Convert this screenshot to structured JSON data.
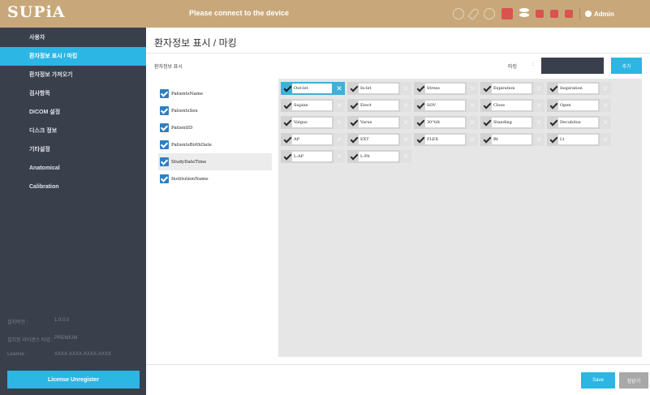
{
  "app": {
    "logo": "SUPiA",
    "device_message": "Please connect to the device",
    "user": "Admin"
  },
  "colors": {
    "accent": "#2bb6e4",
    "sidebar": "#3a3f4c",
    "titlebar": "#c8a87a",
    "checkbox": "#2f7fc1",
    "status_alert": "#d9534f"
  },
  "header_icons": [
    "status-circle-icon",
    "paperclip-icon",
    "status-circle-icon",
    "red-square-icon",
    "database-icon",
    "red-square-icon",
    "red-square-icon",
    "red-square-icon"
  ],
  "sidebar": {
    "items": [
      {
        "label": "사용자"
      },
      {
        "label": "환자정보 표시 / 마킹",
        "active": true
      },
      {
        "label": "환자정보 가져오기"
      },
      {
        "label": "검사항목"
      },
      {
        "label": "DICOM 설정"
      },
      {
        "label": "디스크 정보"
      },
      {
        "label": "기타설정"
      },
      {
        "label": "Anatomical"
      },
      {
        "label": "Calibration"
      }
    ],
    "info": [
      {
        "label": "설치버전 :",
        "value": "1.0.0.0"
      },
      {
        "label": "설치된 라이센스 타입 :",
        "value": "PREMIUM"
      },
      {
        "label": "License :",
        "value": "XXXX-XXXX-XXXX-XXXX"
      }
    ],
    "unregister_label": "License Unregister"
  },
  "main": {
    "title": "환자정보 표시 / 마킹",
    "section_label": "환자정보 표시",
    "marking_label": "마킹",
    "marking_colon": ":",
    "marking_value": "",
    "add_label": "추가",
    "fields": [
      {
        "label": "PatientsName",
        "checked": true
      },
      {
        "label": "PatientsSex",
        "checked": true
      },
      {
        "label": "PatientID",
        "checked": true
      },
      {
        "label": "PatientsBirthDate",
        "checked": true
      },
      {
        "label": "StudyDateTime",
        "checked": true,
        "selected": true
      },
      {
        "label": "InstitutionName",
        "checked": true
      }
    ],
    "markings": [
      [
        "Out-let",
        "In-let",
        "Stress",
        "Expiration",
        "Inspiration"
      ],
      [
        "Supine",
        "Erect",
        "SOV",
        "Close",
        "Open"
      ],
      [
        "Valgus",
        "Varus",
        "30°tilt",
        "Standing",
        "Decubitus"
      ],
      [
        "AP",
        "EXT",
        "FLEX",
        "Rt",
        "Lt"
      ],
      [
        "L-AP",
        "L-PA"
      ]
    ],
    "active_marking": "Out-let",
    "save_label": "Save",
    "close_label": "창닫기"
  }
}
